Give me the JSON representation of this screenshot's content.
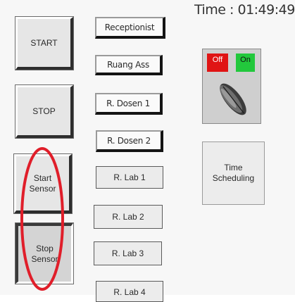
{
  "clock": {
    "text": "Time : 01:49:49"
  },
  "controls": {
    "start": "START",
    "stop": "STOP",
    "start_sensor": "Start\nSensor",
    "stop_sensor": "Stop\nSensor"
  },
  "rooms": [
    "Receptionist",
    "Ruang Ass",
    "R. Dosen 1",
    "R. Dosen 2",
    "R. Lab 1",
    "R. Lab 2",
    "R. Lab 3",
    "R. Lab 4"
  ],
  "switch": {
    "off_label": "Off",
    "on_label": "On",
    "state": "on",
    "icon": "rotary-switch-icon"
  },
  "scheduling": {
    "label": "Time\nScheduling"
  },
  "annotation": {
    "shape": "red-ellipse",
    "color": "#e01e2a"
  },
  "colors": {
    "off": "#e01414",
    "on": "#22c83c",
    "background": "#f7f7f7"
  }
}
